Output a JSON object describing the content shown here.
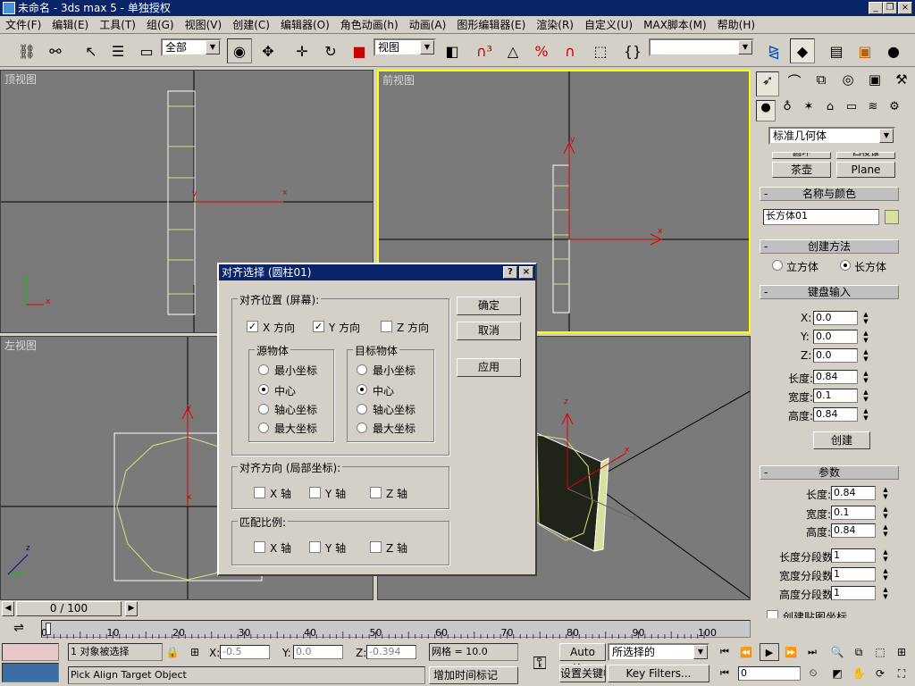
{
  "window": {
    "title": "未命名 - 3ds max 5 - 单独授权"
  },
  "menu": [
    "文件(F)",
    "编辑(E)",
    "工具(T)",
    "组(G)",
    "视图(V)",
    "创建(C)",
    "编辑器(O)",
    "角色动画(h)",
    "动画(A)",
    "图形编辑器(E)",
    "渲染(R)",
    "自定义(U)",
    "MAX脚本(M)",
    "帮助(H)"
  ],
  "toolbar": {
    "selection_filter": "全部",
    "ref_coord": "视图",
    "named_selection": ""
  },
  "viewports": {
    "top": "顶视图",
    "front": "前视图",
    "left": "左视图",
    "perspective": ""
  },
  "axis": {
    "x": "x",
    "y": "y",
    "z": "z"
  },
  "command_panel": {
    "category": "标准几何体",
    "partial_buttons": [
      "圆环",
      "四棱锥"
    ],
    "buttons": [
      "茶壶",
      "Plane"
    ],
    "name_color": {
      "header": "名称与颜色",
      "name": "长方体01",
      "swatch": "#d8e0a0"
    },
    "creation_method": {
      "header": "创建方法",
      "cube": "立方体",
      "box": "长方体"
    },
    "keyboard_entry": {
      "header": "键盘输入",
      "x_label": "X:",
      "x": "0.0",
      "y_label": "Y:",
      "y": "0.0",
      "z_label": "Z:",
      "z": "0.0",
      "length_label": "长度:",
      "length": "0.84",
      "width_label": "宽度:",
      "width": "0.1",
      "height_label": "高度:",
      "height": "0.84",
      "create": "创建"
    },
    "parameters": {
      "header": "参数",
      "length_label": "长度:",
      "length": "0.84",
      "width_label": "宽度:",
      "width": "0.1",
      "height_label": "高度:",
      "height": "0.84",
      "length_segs_label": "长度分段数:",
      "length_segs": "1",
      "width_segs_label": "宽度分段数:",
      "width_segs": "1",
      "height_segs_label": "高度分段数:",
      "height_segs": "1",
      "gen_mapping": "创建贴图坐标"
    },
    "minus": "-"
  },
  "dialog": {
    "title": "对齐选择 (圆柱01)",
    "help": "?",
    "close": "×",
    "align_position": "对齐位置 (屏幕):",
    "x_pos": "X 方向",
    "y_pos": "Y 方向",
    "z_pos": "Z 方向",
    "source": "源物体",
    "target": "目标物体",
    "min": "最小坐标",
    "center": "中心",
    "pivot": "轴心坐标",
    "max": "最大坐标",
    "ok": "确定",
    "cancel": "取消",
    "apply": "应用",
    "align_orient": "对齐方向 (局部坐标):",
    "match_scale": "匹配比例:",
    "x_axis": "X 轴",
    "y_axis": "Y 轴",
    "z_axis": "Z 轴"
  },
  "timeline": {
    "frame": "0 / 100",
    "ticks": [
      "0",
      "10",
      "20",
      "30",
      "40",
      "50",
      "60",
      "70",
      "80",
      "90",
      "100"
    ]
  },
  "status": {
    "selected": "1 对象被选择",
    "prompt": "Pick Align Target Object",
    "x_label": "X:",
    "x": "-0.5",
    "y_label": "Y:",
    "y": "0.0",
    "z_label": "Z:",
    "z": "-0.394",
    "grid": "网格 = 10.0",
    "add_time_tag": "增加时间标记",
    "auto_key": "Auto Key",
    "set_key": "设置关键帧",
    "key_mode": "所选择的",
    "key_filters": "Key Filters...",
    "current_frame": "0"
  }
}
